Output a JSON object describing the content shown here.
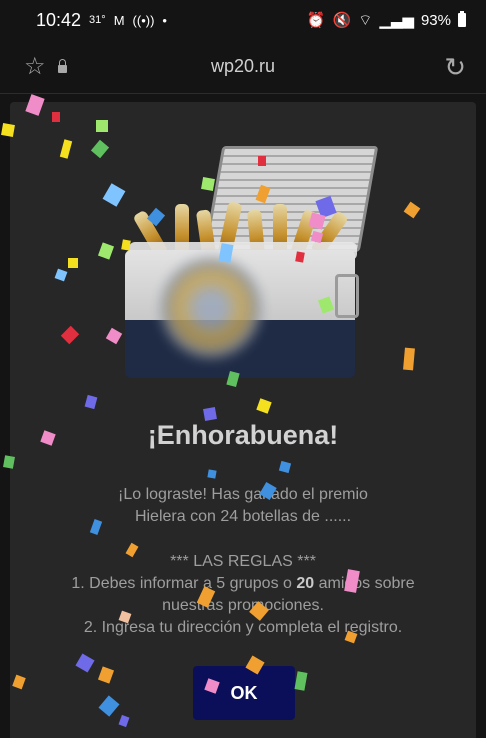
{
  "status_bar": {
    "time": "10:42",
    "temp": "31°",
    "notification_icons": [
      "gmail-icon",
      "broadcast-icon",
      "dot-icon"
    ],
    "battery": "93%"
  },
  "address_bar": {
    "url": "wp20.ru"
  },
  "popup": {
    "title": "¡Enhorabuena!",
    "prize_line1": "¡Lo lograste! Has ganado el premio",
    "prize_line2": "Hielera con 24 botellas de ......",
    "rules_heading": "*** LAS REGLAS ***",
    "rule1_pre": "1. Debes informar a 5 grupos o ",
    "rule1_bold": "20",
    "rule1_post": " amigos sobre",
    "rule1_cont": "nuestras promociones.",
    "rule2": "2. Ingresa tu dirección y completa el registro.",
    "ok_label": "OK"
  },
  "colors": {
    "background": "#141414",
    "popup": "#272727",
    "ok_button": "#0b0f5a",
    "confetti": [
      "#f08cc8",
      "#9fe86e",
      "#7fc4ff",
      "#f0a030",
      "#f5e020",
      "#6e6ae8",
      "#e03040",
      "#60c060",
      "#4090e0",
      "#f0c0a0"
    ]
  }
}
